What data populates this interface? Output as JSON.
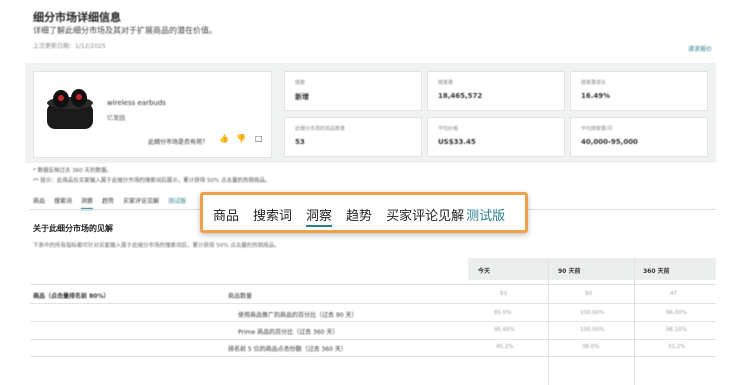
{
  "header": {
    "title": "细分市场详细信息",
    "subtitle": "详细了解此细分市场及其对于扩展商品的潜在价值。",
    "updated": "上次更新日期：1/12/2025",
    "request_link": "请求报价"
  },
  "product": {
    "name": "wireless earbuds",
    "brand": "亿发园",
    "useful_question": "此细分市场是否有用？"
  },
  "metrics": [
    {
      "label": "搜索",
      "value": "新增"
    },
    {
      "label": "搜索量",
      "value": "18,465,572"
    },
    {
      "label": "搜索量增长",
      "value": "16.49%"
    },
    {
      "label": "此细分市场的商品数量",
      "value": "53"
    },
    {
      "label": "平均价格",
      "value": "US$33.45"
    },
    {
      "label": "平均搜索量/月",
      "value": "40,000-95,000"
    }
  ],
  "notes": [
    "* 数据反映过去 360 天的数据。",
    "** 提示：此商品在买家输入属于此细分市场的搜索词后展示，累计获得 50% 点击量的热销商品。"
  ],
  "tabs_small": [
    "商品",
    "搜索词",
    "洞察",
    "趋势",
    "买家评论见解",
    "测试版"
  ],
  "section": {
    "title": "关于此细分市场的见解",
    "desc": "下表中的所有指标都可针对买家输入属于此细分市场的搜索词后，累计获得 50% 点击量的热销商品。"
  },
  "overlay_tabs": [
    "商品",
    "搜索词",
    "洞察",
    "趋势",
    "买家评论见解",
    "测试版"
  ],
  "table": {
    "columns": [
      "今天",
      "90 天前",
      "360 天前"
    ],
    "rows": [
      {
        "label": "商品（点击量排名前 80%）",
        "sub": "商品数量",
        "values": [
          "53",
          "50",
          "47"
        ]
      },
      {
        "label": "",
        "sub": "使用商品推广的商品的百分比（过去 90 天）",
        "values": [
          "85.0%",
          "100.00%",
          "96.00%"
        ]
      },
      {
        "label": "",
        "sub": "Prime 商品的百分比（过去 360 天）",
        "values": [
          "95.60%",
          "100.00%",
          "98.10%"
        ]
      },
      {
        "label": "",
        "sub": "排名前 5 位的商品点击份额（过去 360 天）",
        "values": [
          "45.2%",
          "38.0%",
          "31.2%"
        ]
      }
    ]
  },
  "colors": {
    "accent": "#2a7f8f",
    "highlight_border": "#f0a04b",
    "panel_bg": "#f0f2f2"
  }
}
